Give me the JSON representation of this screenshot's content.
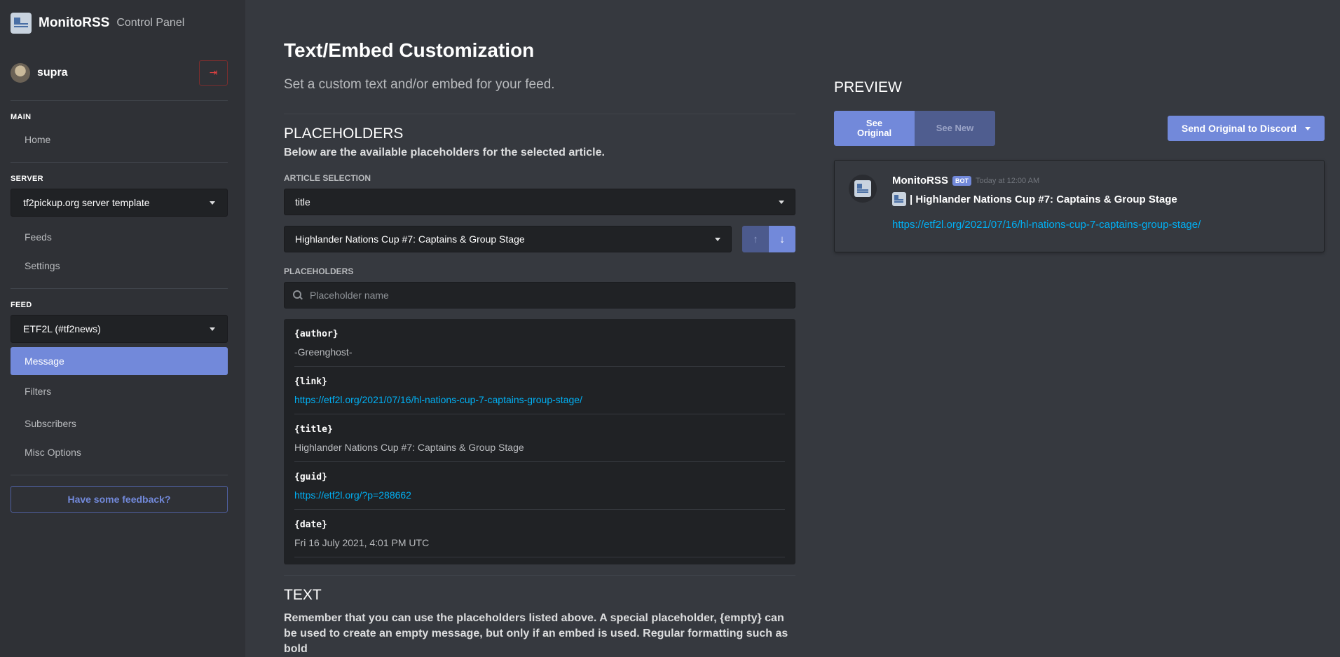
{
  "brand": {
    "name": "MonitoRSS",
    "sub": "Control Panel"
  },
  "user": {
    "name": "supra"
  },
  "sidebar": {
    "main_label": "MAIN",
    "home": "Home",
    "server_label": "SERVER",
    "server_selected": "tf2pickup.org server template",
    "feeds": "Feeds",
    "settings": "Settings",
    "feed_label": "FEED",
    "feed_selected": "ETF2L (#tf2news)",
    "message": "Message",
    "filters": "Filters",
    "subscribers": "Subscribers",
    "misc": "Misc Options",
    "feedback": "Have some feedback?"
  },
  "main": {
    "title": "Text/Embed Customization",
    "subtitle": "Set a custom text and/or embed for your feed.",
    "placeholders_heading": "PLACEHOLDERS",
    "placeholders_desc": "Below are the available placeholders for the selected article.",
    "article_selection_label": "ARTICLE SELECTION",
    "article_field": "title",
    "article_selected": "Highlander Nations Cup #7: Captains & Group Stage",
    "placeholders_label": "PLACEHOLDERS",
    "search_placeholder": "Placeholder name",
    "items": [
      {
        "key": "{author}",
        "value": "-Greenghost-"
      },
      {
        "key": "{link}",
        "value": "https://etf2l.org/2021/07/16/hl-nations-cup-7-captains-group-stage/"
      },
      {
        "key": "{title}",
        "value": "Highlander Nations Cup #7: Captains & Group Stage"
      },
      {
        "key": "{guid}",
        "value": "https://etf2l.org/?p=288662"
      },
      {
        "key": "{date}",
        "value": "Fri 16 July 2021, 4:01 PM UTC"
      }
    ],
    "text_heading": "TEXT",
    "text_desc": "Remember that you can use the placeholders listed above. A special placeholder, {empty} can be used to create an empty message, but only if an embed is used. Regular formatting such as bold"
  },
  "preview": {
    "title": "PREVIEW",
    "see_original": "See Original",
    "see_new": "See New",
    "send_button": "Send Original to Discord",
    "author": "MonitoRSS",
    "bot_tag": "BOT",
    "time": "Today at 12:00 AM",
    "line": "| Highlander Nations Cup #7: Captains & Group Stage",
    "link": "https://etf2l.org/2021/07/16/hl-nations-cup-7-captains-group-stage/"
  }
}
